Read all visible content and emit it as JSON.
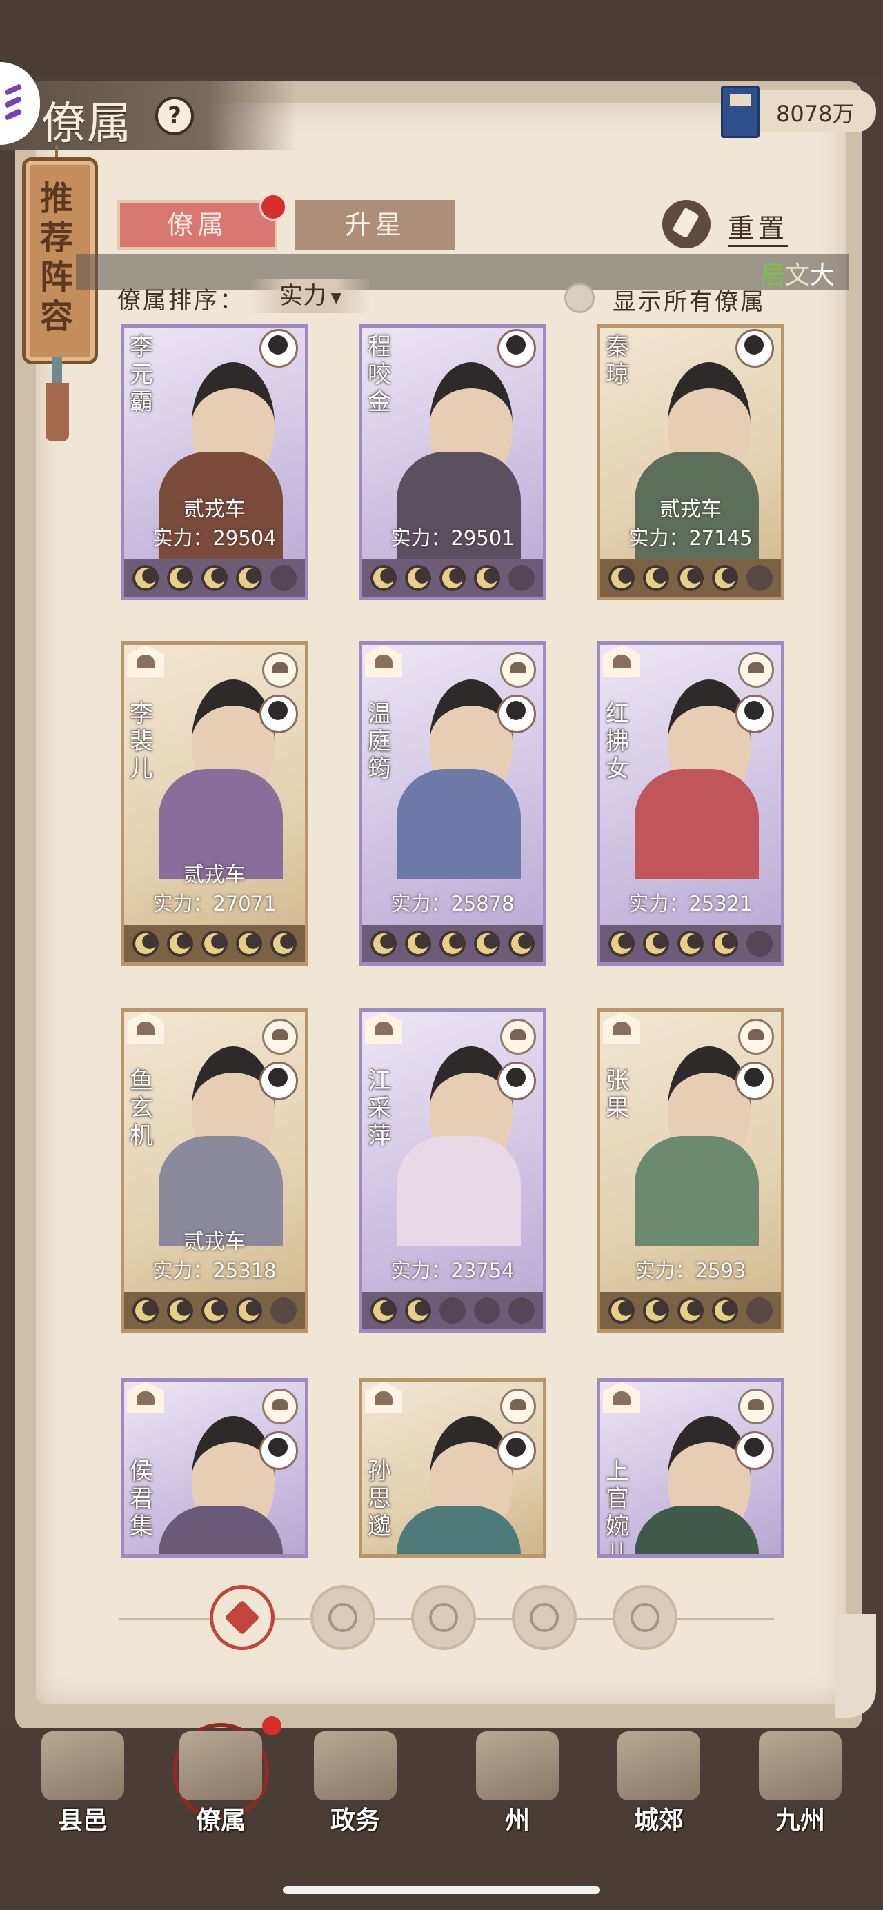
{
  "header": {
    "title": "僚属",
    "silver_amount": "8078万"
  },
  "left_tag": {
    "label": "推荐阵容"
  },
  "tabs": [
    {
      "label": "僚属",
      "active": true
    },
    {
      "label": "升星",
      "active": false
    }
  ],
  "reset_label": "重置",
  "subtitle_overlay": [
    "居",
    "文",
    "大"
  ],
  "sort": {
    "label": "僚属排序：",
    "selected": "实力"
  },
  "show_all_label": "显示所有僚属",
  "retainers": [
    {
      "name": "李元霸",
      "rank": "贰戎车",
      "power": "实力：29504",
      "stars": 4,
      "frame": "purple"
    },
    {
      "name": "程咬金",
      "rank": "",
      "power": "实力：29501",
      "stars": 4,
      "frame": "purple"
    },
    {
      "name": "秦琼",
      "rank": "贰戎车",
      "power": "实力：27145",
      "stars": 4,
      "frame": "gold"
    },
    {
      "name": "李裴儿",
      "rank": "贰戎车",
      "power": "实力：27071",
      "stars": 5,
      "frame": "gold"
    },
    {
      "name": "温庭筠",
      "rank": "",
      "power": "实力：25878",
      "stars": 5,
      "frame": "purple"
    },
    {
      "name": "红拂女",
      "rank": "",
      "power": "实力：25321",
      "stars": 4,
      "frame": "purple"
    },
    {
      "name": "鱼玄机",
      "rank": "贰戎车",
      "power": "实力：25318",
      "stars": 4,
      "frame": "gold"
    },
    {
      "name": "江采萍",
      "rank": "",
      "power": "实力：23754",
      "stars": 2,
      "frame": "purple"
    },
    {
      "name": "张果",
      "rank": "",
      "power": "实力：2593",
      "stars": 4,
      "frame": "gold"
    },
    {
      "name": "侯君集",
      "rank": "",
      "power": "",
      "stars": 0,
      "frame": "purple"
    },
    {
      "name": "孙思邈",
      "rank": "",
      "power": "",
      "stars": 0,
      "frame": "gold"
    },
    {
      "name": "上官婉儿",
      "rank": "",
      "power": "",
      "stars": 0,
      "frame": "purple"
    }
  ],
  "filters": [
    "all-filter-icon",
    "scholar-filter-icon",
    "gourd-filter-icon",
    "fan-filter-icon",
    "beast-filter-icon"
  ],
  "nav": [
    {
      "label": "县邑"
    },
    {
      "label": "僚属"
    },
    {
      "label": "政务"
    },
    {
      "label": "州"
    },
    {
      "label": "城郊"
    },
    {
      "label": "九州"
    }
  ],
  "colors": {
    "accent_red": "#d97773",
    "purple_frame": "#9d8ac2",
    "gold_frame": "#b8966a",
    "paper": "#efe6d6"
  }
}
